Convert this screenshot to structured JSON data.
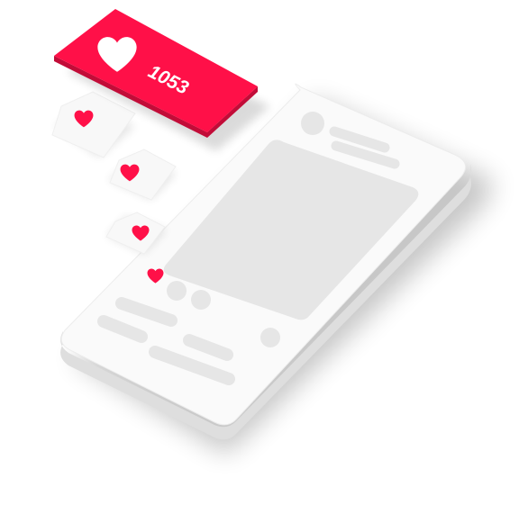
{
  "like_badge": {
    "count": "1053",
    "icon": "heart-icon"
  },
  "colors": {
    "accent": "#ff1048",
    "phone_face": "#fafafa",
    "placeholder": "#e6e6e6",
    "background": "#ffffff"
  },
  "reactions": [
    {
      "icon": "heart-icon"
    },
    {
      "icon": "heart-icon"
    },
    {
      "icon": "heart-icon"
    },
    {
      "icon": "heart-icon"
    }
  ]
}
